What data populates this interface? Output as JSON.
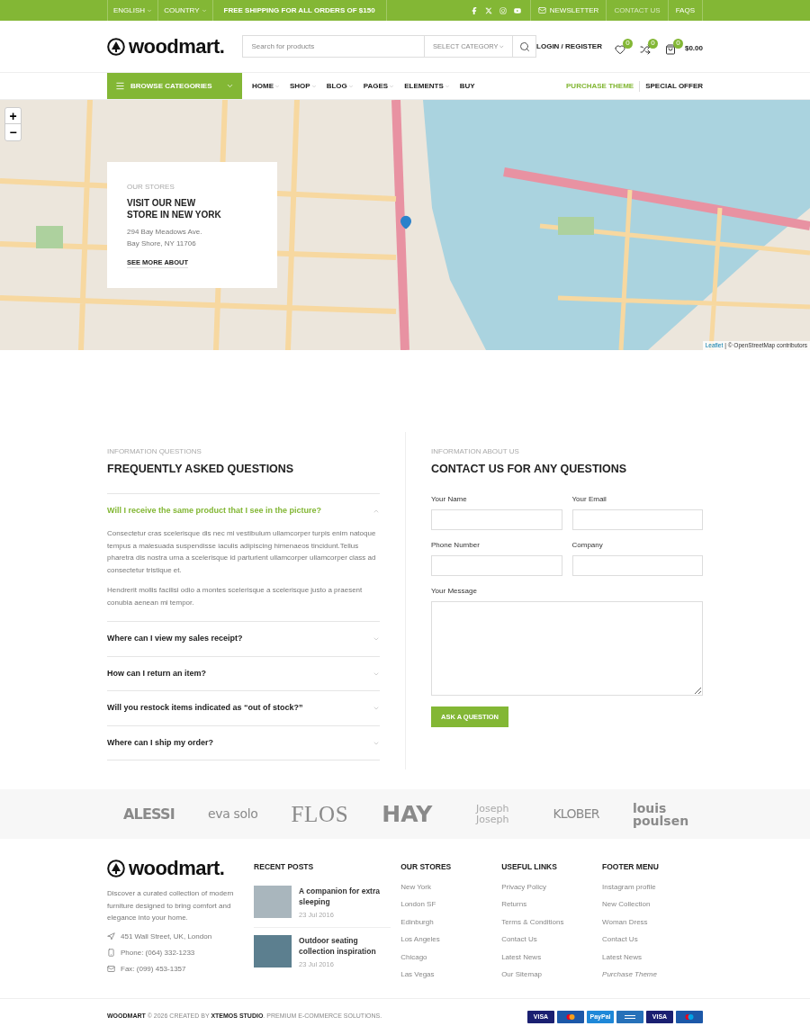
{
  "top_bar": {
    "left": [
      {
        "label": "ENGLISH",
        "dropdown": true
      },
      {
        "label": "COUNTRY",
        "dropdown": true
      }
    ],
    "promo": "FREE SHIPPING FOR ALL ORDERS OF $150",
    "socials": [
      {
        "kind": "facebook"
      },
      {
        "kind": "x"
      },
      {
        "kind": "instagram"
      },
      {
        "kind": "youtube"
      }
    ],
    "links": [
      {
        "label": "NEWSLETTER",
        "kind": "mail",
        "selected": false
      },
      {
        "label": "CONTACT US",
        "kind": "plain",
        "selected": true
      },
      {
        "label": "FAQS",
        "kind": "plain",
        "selected": false
      }
    ]
  },
  "header": {
    "logo": "woodmart.",
    "search": {
      "placeholder": "Search for products",
      "category": "SELECT CATEGORY"
    },
    "login": "LOGIN / REGISTER",
    "actions": [
      {
        "kind": "wishlist",
        "count": "0"
      },
      {
        "kind": "compare",
        "count": "0"
      },
      {
        "kind": "cart",
        "count": "0",
        "total": "$0.00"
      }
    ]
  },
  "nav": {
    "browse": "BROWSE CATEGORIES",
    "items": [
      {
        "label": "HOME",
        "dropdown": true
      },
      {
        "label": "SHOP",
        "dropdown": true
      },
      {
        "label": "BLOG",
        "dropdown": true
      },
      {
        "label": "PAGES",
        "dropdown": true
      },
      {
        "label": "ELEMENTS",
        "dropdown": true
      },
      {
        "label": "BUY",
        "dropdown": false
      }
    ],
    "right": [
      {
        "label": "PURCHASE THEME",
        "highlighted": true
      },
      {
        "label": "SPECIAL OFFER",
        "highlighted": false
      }
    ]
  },
  "map": {
    "zoom_in": "+",
    "zoom_out": "−",
    "attribution_link": "Leaflet",
    "attribution": "| © OpenStreetMap contributors",
    "card": {
      "subtitle": "OUR STORES",
      "title": "VISIT OUR NEW STORE IN NEW YORK",
      "address": [
        "294 Bay Meadows Ave.",
        "Bay Shore, NY 11706"
      ],
      "link": "SEE MORE ABOUT"
    }
  },
  "faq": {
    "subtitle": "INFORMATION QUESTIONS",
    "title": "FREQUENTLY ASKED QUESTIONS",
    "items": [
      {
        "question": "Will I receive the same product that I see in the picture?",
        "expanded": true,
        "answer": [
          "Consectetur cras scelerisque dis nec mi vestibulum ullamcorper turpis enim natoque tempus a malesuada suspendisse iaculis adipiscing himenaeos tincidunt.Tellus pharetra dis nostra urna a scelerisque id parturient ullamcorper ullamcorper class ad consectetur tristique et.",
          "Hendrerit mollis facilisi odio a montes scelerisque a scelerisque justo a praesent conubia aenean mi tempor."
        ]
      },
      {
        "question": "Where can I view my sales receipt?",
        "expanded": false
      },
      {
        "question": "How can I return an item?",
        "expanded": false
      },
      {
        "question": "Will you restock items indicated as “out of stock?”",
        "expanded": false
      },
      {
        "question": "Where can I ship my order?",
        "expanded": false
      }
    ]
  },
  "contact": {
    "subtitle": "INFORMATION ABOUT US",
    "title": "CONTACT US FOR ANY QUESTIONS",
    "fields": [
      {
        "label": "Your Name",
        "kind": "input"
      },
      {
        "label": "Your Email",
        "kind": "input"
      },
      {
        "label": "Phone Number",
        "kind": "input"
      },
      {
        "label": "Company",
        "kind": "input"
      },
      {
        "label": "Your Message",
        "kind": "textarea"
      }
    ],
    "submit": "ASK A QUESTION"
  },
  "brands": [
    {
      "name": "ALESSI",
      "kind": "heavy"
    },
    {
      "name": "eva solo",
      "kind": "round"
    },
    {
      "name": "FLOS",
      "kind": "serif"
    },
    {
      "name": "HAY",
      "kind": "block"
    },
    {
      "name": "Joseph Joseph",
      "kind": "outline"
    },
    {
      "name": "KLOBER",
      "kind": "wide"
    },
    {
      "name": "louis poulsen",
      "kind": "stack"
    }
  ],
  "footer": {
    "logo": "woodmart.",
    "about": "Discover a curated collection of modern furniture designed to bring comfort and elegance into your home.",
    "contacts": [
      {
        "kind": "address",
        "text": "451 Wall Street, UK, London"
      },
      {
        "kind": "phone",
        "text": "Phone: (064) 332-1233"
      },
      {
        "kind": "fax",
        "text": "Fax: (099) 453-1357"
      }
    ],
    "recent_posts": {
      "title": "RECENT POSTS",
      "posts": [
        {
          "title": "A companion for extra sleeping",
          "date": "23 Jul 2016"
        },
        {
          "title": "Outdoor seating collection inspiration",
          "date": "23 Jul 2016"
        }
      ]
    },
    "columns": [
      {
        "title": "OUR STORES",
        "links": [
          {
            "label": "New York",
            "italic": false
          },
          {
            "label": "London SF",
            "italic": false
          },
          {
            "label": "Edinburgh",
            "italic": false
          },
          {
            "label": "Los Angeles",
            "italic": false
          },
          {
            "label": "Chicago",
            "italic": false
          },
          {
            "label": "Las Vegas",
            "italic": false
          }
        ]
      },
      {
        "title": "USEFUL LINKS",
        "links": [
          {
            "label": "Privacy Policy",
            "italic": false
          },
          {
            "label": "Returns",
            "italic": false
          },
          {
            "label": "Terms & Conditions",
            "italic": false
          },
          {
            "label": "Contact Us",
            "italic": false
          },
          {
            "label": "Latest News",
            "italic": false
          },
          {
            "label": "Our Sitemap",
            "italic": false
          }
        ]
      },
      {
        "title": "FOOTER MENU",
        "links": [
          {
            "label": "Instagram profile",
            "italic": false
          },
          {
            "label": "New Collection",
            "italic": false
          },
          {
            "label": "Woman Dress",
            "italic": false
          },
          {
            "label": "Contact Us",
            "italic": false
          },
          {
            "label": "Latest News",
            "italic": false
          },
          {
            "label": "Purchase Theme",
            "italic": true
          }
        ]
      }
    ]
  },
  "bottom_bar": {
    "copyright": "**WOODMART** © 2026 CREATED BY **XTEMOS STUDIO**. PREMIUM E-COMMERCE SOLUTIONS.",
    "payments": [
      {
        "kind": "visa",
        "label": "VISA"
      },
      {
        "kind": "mastercard"
      },
      {
        "kind": "paypal",
        "label": "PayPal"
      },
      {
        "kind": "amex"
      },
      {
        "kind": "visa",
        "label": "VISA"
      },
      {
        "kind": "maestro"
      }
    ]
  }
}
